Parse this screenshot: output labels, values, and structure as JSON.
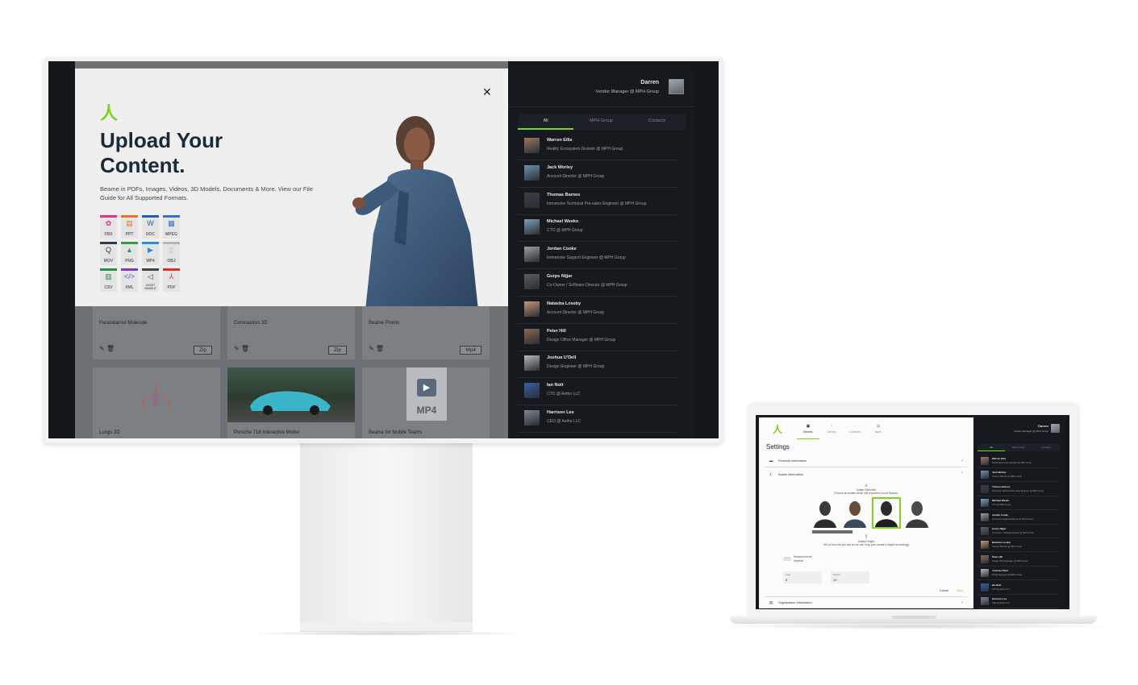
{
  "monitor": {
    "modal": {
      "title_line1": "Upload Your",
      "title_line2": "Content.",
      "description": "Beame in PDFs, Images, Videos, 3D Models, Documents & More. View our File Guide for All Supported Formats.",
      "close_icon": "close-icon",
      "file_types": [
        {
          "label": "FBX",
          "color": "#e2338b",
          "glyph": "✿"
        },
        {
          "label": "PPT",
          "color": "#e8732c",
          "glyph": "▤"
        },
        {
          "label": "DOC",
          "color": "#2b5ea8",
          "glyph": "W"
        },
        {
          "label": "MPEG",
          "color": "#3574c4",
          "glyph": "▦"
        },
        {
          "label": "MOV",
          "color": "#2f3a45",
          "glyph": "Q"
        },
        {
          "label": "PNG",
          "color": "#3a9a4a",
          "glyph": "▲"
        },
        {
          "label": "MP4",
          "color": "#2f8ad8",
          "glyph": "▶"
        },
        {
          "label": "OBJ",
          "color": "#b5b5b5",
          "glyph": "▯"
        },
        {
          "label": "CSV",
          "color": "#2e8b47",
          "glyph": "▥"
        },
        {
          "label": "XML",
          "color": "#7b3fb0",
          "glyph": "</>"
        },
        {
          "label": "ASSET BUNDLE",
          "color": "#444444",
          "glyph": "◁"
        },
        {
          "label": "PDF",
          "color": "#d93030",
          "glyph": "⅄"
        }
      ]
    },
    "library": {
      "cards": [
        {
          "title": "Paracetamol Molecule",
          "badge": "Zip"
        },
        {
          "title": "Coronavirus 3D",
          "badge": "Zip"
        },
        {
          "title": "Beame Promo",
          "badge": "Mp4"
        }
      ],
      "tile_mp4_label": "MP4",
      "bottom_captions": [
        "Lungs 3D",
        "Porsche 718 Interactive Model",
        "Beame for Mobile Teams"
      ]
    },
    "panel": {
      "user_name": "Darren",
      "user_role": "Vendor Manager @ MPH Group",
      "tabs": [
        "All",
        "MPH Group",
        "Contacts"
      ],
      "contacts": [
        {
          "name": "Warren Ellis",
          "role": "Reality Ecosystem Division @ MPH Group",
          "color": "#9a7a62"
        },
        {
          "name": "Jack Worley",
          "role": "Account Director @ MPH Group",
          "color": "#6f8fb0"
        },
        {
          "name": "Thomas Barnes",
          "role": "Immersive Technical Pre-sales Engineer @ MPH Group",
          "color": "#3a3f47"
        },
        {
          "name": "Michael Weeks",
          "role": "CTO @ MPH Group",
          "color": "#7aa0b8"
        },
        {
          "name": "Jordan Cooke",
          "role": "Immersive Support Engineer @ MPH Group",
          "color": "#9e9e9e"
        },
        {
          "name": "Gurps Nijjar",
          "role": "Co-Owner / Software Director @ MPH Group",
          "color": "#5a5e64"
        },
        {
          "name": "Natasha Loseby",
          "role": "Account Director @ MPH Group",
          "color": "#c99676"
        },
        {
          "name": "Peter Hill",
          "role": "Design Office Manager @ MPH Group",
          "color": "#8a6a50"
        },
        {
          "name": "Joshua U'Dell",
          "role": "Design Engineer @ MPH Group",
          "color": "#b8b8b8"
        },
        {
          "name": "Ian Nott",
          "role": "CTO @ Aetho LLC",
          "color": "#3b5fa8"
        },
        {
          "name": "Harrison Lee",
          "role": "CEO @ Aetho LLC",
          "color": "#7c8894"
        }
      ]
    }
  },
  "laptop": {
    "nav": [
      {
        "label": "Beams",
        "icon": "beams-icon"
      },
      {
        "label": "Library",
        "icon": "library-icon"
      },
      {
        "label": "Contacts",
        "icon": "contacts-icon"
      },
      {
        "label": "Apps",
        "icon": "apps-icon"
      }
    ],
    "settings_title": "Settings",
    "sections": [
      "Personal Information",
      "Avatar Information",
      "Organization Information"
    ],
    "avatar_selection_label": "Avatar Selection",
    "avatar_selection_hint": "Choose an avatar which will represent you in Beame.",
    "avatar_height_label": "Avatar Height",
    "avatar_height_hint": "Tell us how tall you are so we can map your avatar's height accordingly",
    "measurements_label": "Measurements",
    "measurements_value": "Imperial",
    "fields": [
      {
        "label": "Feet",
        "value": "5"
      },
      {
        "label": "Inches",
        "value": "10"
      }
    ],
    "cancel_label": "Cancel",
    "save_label": "Save",
    "panel": {
      "user_name": "Darren",
      "user_role": "Vendor Manager @ MPH Group",
      "tabs": [
        "All",
        "MPH Group",
        "Contacts"
      ],
      "contacts": [
        {
          "name": "Warren Ellis",
          "role": "Reality Ecosystem Division @ MPH Group",
          "color": "#9a7a62"
        },
        {
          "name": "Jack Worley",
          "role": "Account Director @ MPH Group",
          "color": "#6f8fb0"
        },
        {
          "name": "Thomas Barnes",
          "role": "Immersive Technical Pre-sales Engineer @ MPH Group",
          "color": "#3a3f47"
        },
        {
          "name": "Michael Weeks",
          "role": "CTO @ MPH Group",
          "color": "#7aa0b8"
        },
        {
          "name": "Jordan Cooke",
          "role": "Immersive Support Engineer @ MPH Group",
          "color": "#9e9e9e"
        },
        {
          "name": "Gurps Nijjar",
          "role": "Co-Owner / Software Director @ MPH Group",
          "color": "#5a5e64"
        },
        {
          "name": "Natasha Loseby",
          "role": "Account Director @ MPH Group",
          "color": "#c99676"
        },
        {
          "name": "Peter Hill",
          "role": "Design Office Manager @ MPH Group",
          "color": "#8a6a50"
        },
        {
          "name": "Joshua U'Dell",
          "role": "Design Engineer @ MPH Group",
          "color": "#b8b8b8"
        },
        {
          "name": "Ian Nott",
          "role": "CTO @ Aetho LLC",
          "color": "#3b5fa8"
        },
        {
          "name": "Harrison Lee",
          "role": "CEO @ Aetho LLC",
          "color": "#7c8894"
        }
      ]
    }
  },
  "colors": {
    "accent": "#7ed321",
    "panel_bg": "#161a1f",
    "modal_bg": "#efefef"
  }
}
